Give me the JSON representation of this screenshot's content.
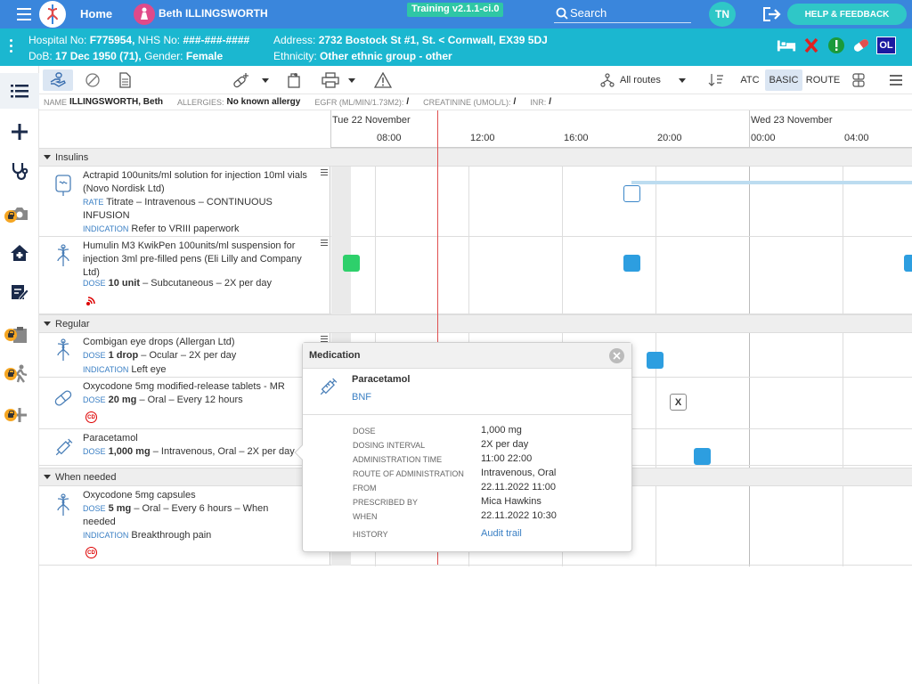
{
  "topbar": {
    "home": "Home",
    "patient_name": "Beth ILLINGSWORTH",
    "training": "Training v2.1.1-ci.0",
    "search": "Search",
    "user_initials": "TN",
    "help": "HELP & FEEDBACK"
  },
  "banner": {
    "hospital_label": "Hospital No:",
    "hospital_no": "F775954,",
    "nhs_label": "NHS No:",
    "nhs_no": "###-###-####",
    "address_label": "Address:",
    "address": "2732 Bostock St #1, St. < Cornwall, EX39 5DJ",
    "dob_label": "DoB:",
    "dob": "17 Dec 1950 (71),",
    "gender_label": "Gender:",
    "gender": "Female",
    "ethnicity_label": "Ethnicity:",
    "ethnicity": "Other ethnic group - other",
    "ol": "OL"
  },
  "toolbar": {
    "routes": "All routes",
    "atc": "ATC",
    "basic": "BASIC",
    "route": "ROUTE"
  },
  "info": {
    "name_label": "NAME",
    "name": "ILLINGSWORTH, Beth",
    "allergies_label": "ALLERGIES:",
    "allergies": "No known allergy",
    "egfr_label": "EGFR (ML/MIN/1.73M2):",
    "egfr": "/",
    "creat_label": "CREATININE (UMOL/L):",
    "creat": "/",
    "inr_label": "INR:",
    "inr": "/"
  },
  "timeline": {
    "day1": "Tue 22 November",
    "day2": "Wed 23 November",
    "hours": [
      "08:00",
      "12:00",
      "16:00",
      "20:00",
      "00:00",
      "04:00"
    ]
  },
  "sections": {
    "insulins": "Insulins",
    "regular": "Regular",
    "when_needed": "When needed"
  },
  "meds": {
    "actrapid": {
      "name": "Actrapid 100units/ml solution for injection 10ml vials (Novo Nordisk Ltd)",
      "rate_tag": "RATE",
      "rate": "Titrate – Intravenous – CONTINUOUS INFUSION",
      "ind_tag": "INDICATION",
      "indication": "Refer to VRIII paperwork"
    },
    "humulin": {
      "name": "Humulin M3 KwikPen 100units/ml suspension for injection 3ml pre-filled pens (Eli Lilly and Company Ltd)",
      "dose_tag": "DOSE",
      "dose_bold": "10 unit",
      "dose_rest": "– Subcutaneous – 2X per day"
    },
    "combigan": {
      "name": "Combigan eye drops (Allergan Ltd)",
      "dose_tag": "DOSE",
      "dose_bold": "1 drop",
      "dose_rest": "– Ocular – 2X per day",
      "ind_tag": "INDICATION",
      "indication": "Left eye"
    },
    "oxy_mr": {
      "name": "Oxycodone 5mg modified-release tablets - MR",
      "dose_tag": "DOSE",
      "dose_bold": "20 mg",
      "dose_rest": "– Oral – Every 12 hours",
      "cd": "CD"
    },
    "paracetamol": {
      "name": "Paracetamol",
      "dose_tag": "DOSE",
      "dose_bold": "1,000 mg",
      "dose_rest": "– Intravenous, Oral – 2X per day"
    },
    "oxy_caps": {
      "name": "Oxycodone 5mg capsules",
      "dose_tag": "DOSE",
      "dose_bold": "5 mg",
      "dose_rest": "– Oral – Every 6 hours – When needed",
      "ind_tag": "INDICATION",
      "indication": "Breakthrough pain",
      "cd": "CD"
    }
  },
  "popover": {
    "title": "Medication",
    "drug": "Paracetamol",
    "bnf": "BNF",
    "rows": [
      {
        "label": "DOSE",
        "value": "1,000 mg"
      },
      {
        "label": "DOSING INTERVAL",
        "value": "2X per day"
      },
      {
        "label": "ADMINISTRATION TIME",
        "value": "11:00 22:00"
      },
      {
        "label": "ROUTE OF ADMINISTRATION",
        "value": "Intravenous, Oral"
      },
      {
        "label": "FROM",
        "value": "22.11.2022 11:00"
      },
      {
        "label": "PRESCRIBED BY",
        "value": "Mica Hawkins"
      },
      {
        "label": "WHEN",
        "value": "22.11.2022 10:30"
      },
      {
        "label": "HISTORY",
        "value": "Audit trail"
      }
    ]
  },
  "grid_x_label": "X"
}
